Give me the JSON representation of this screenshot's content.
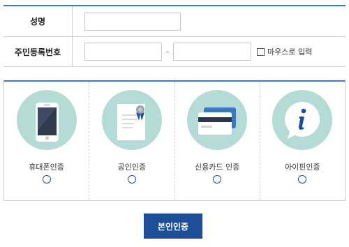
{
  "form": {
    "name_label": "성명",
    "name_value": "",
    "rrn_label": "주민등록번호",
    "rrn_front_value": "",
    "rrn_back_value": "",
    "rrn_separator": "-",
    "mouse_input_label": "마우스로 입력",
    "mouse_input_checked": false
  },
  "auth_methods": [
    {
      "label": "휴대폰인증",
      "icon": "mobile-phone-icon",
      "selected": false
    },
    {
      "label": "공인인증",
      "icon": "certificate-icon",
      "selected": false
    },
    {
      "label": "신용카드 인증",
      "icon": "credit-card-icon",
      "selected": false
    },
    {
      "label": "아이핀인증",
      "icon": "info-bubble-icon",
      "selected": false
    }
  ],
  "submit_label": "본인인증",
  "colors": {
    "accent_border": "#3a7fc4",
    "icon_circle": "#b4dbd6",
    "button": "#1c4f98"
  }
}
